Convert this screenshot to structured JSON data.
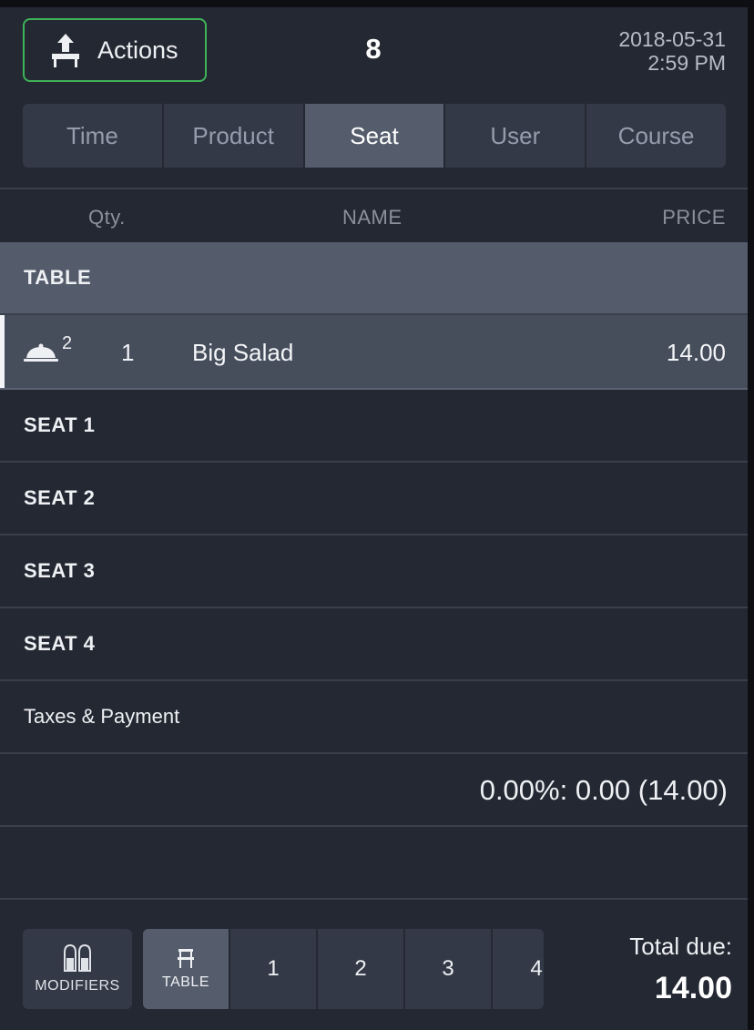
{
  "header": {
    "actions_label": "Actions",
    "order_number": "8",
    "date": "2018-05-31",
    "time": "2:59 PM"
  },
  "tabs": [
    {
      "label": "Time",
      "active": false
    },
    {
      "label": "Product",
      "active": false
    },
    {
      "label": "Seat",
      "active": true
    },
    {
      "label": "User",
      "active": false
    },
    {
      "label": "Course",
      "active": false
    }
  ],
  "columns": {
    "qty": "Qty.",
    "name": "NAME",
    "price": "PRICE"
  },
  "groups": {
    "table": "TABLE",
    "seat1": "SEAT 1",
    "seat2": "SEAT 2",
    "seat3": "SEAT 3",
    "seat4": "SEAT 4",
    "taxes": "Taxes & Payment"
  },
  "item": {
    "course": "2",
    "qty": "1",
    "name": "Big Salad",
    "price": "14.00"
  },
  "taxes_summary": "0.00%: 0.00 (14.00)",
  "footer": {
    "modifiers_label": "MODIFIERS",
    "seat_options": {
      "table": "TABLE",
      "s1": "1",
      "s2": "2",
      "s3": "3",
      "s4": "4"
    },
    "total_label": "Total due:",
    "total_value": "14.00"
  },
  "colors": {
    "accent_green": "#3fb358",
    "panel_bg": "#242833",
    "selected_bg": "#555d6c"
  }
}
